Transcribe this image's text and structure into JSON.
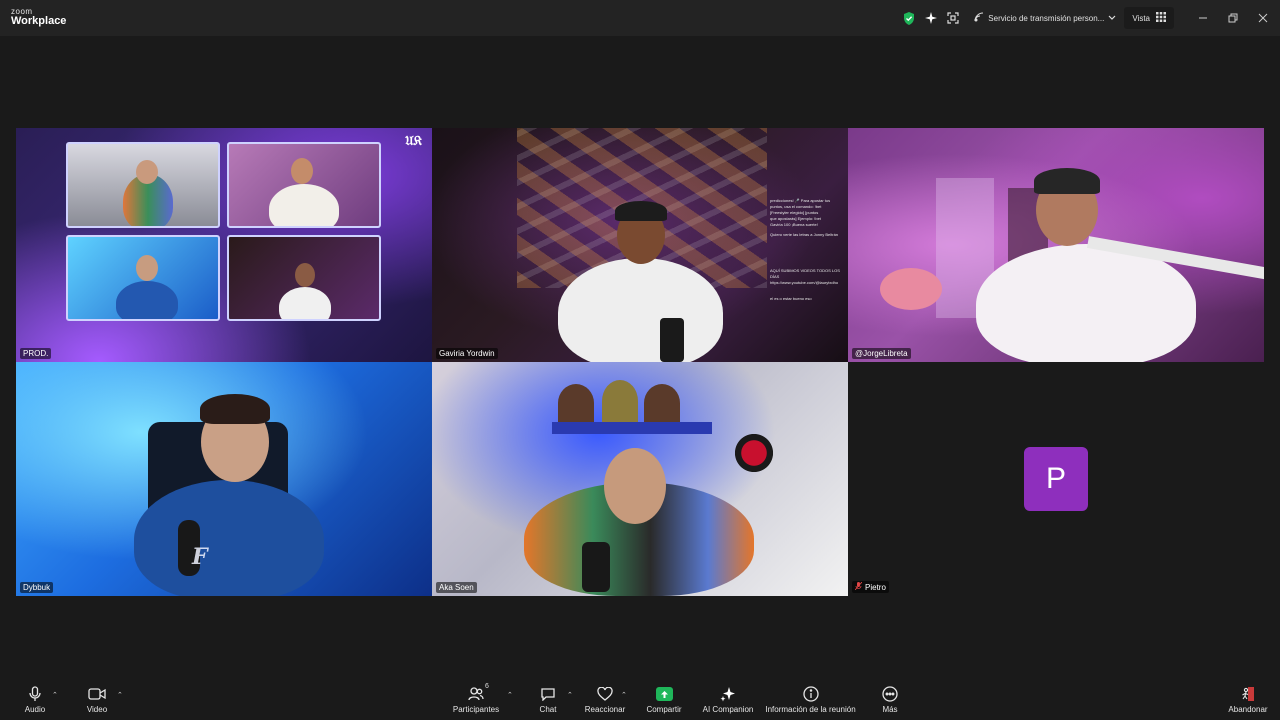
{
  "app": {
    "logo_top": "zoom",
    "logo_bottom": "Workplace"
  },
  "titlebar": {
    "stream_label": "Servicio de transmisión person...",
    "view_label": "Vista",
    "icons": [
      "shield-check-icon",
      "sparkle-icon",
      "fullscreen-icon",
      "broadcast-icon",
      "grid-icon",
      "minimize-icon",
      "restore-icon",
      "close-icon"
    ],
    "accent_color": "#1fb65a"
  },
  "participants": [
    {
      "name": "PROD."
    },
    {
      "name": "Gaviria Yordwin"
    },
    {
      "name": "@JorgeLibreta",
      "active_speaker": true
    },
    {
      "name": "Dybbuk"
    },
    {
      "name": "Aka Soen"
    },
    {
      "name": "Pietro",
      "avatar_letter": "P",
      "avatar_color": "#8e2fbd",
      "muted": true
    }
  ],
  "overlay_chat": {
    "lines": [
      "predicciones! 🎤 Para apostar tus",
      "puntos, usa el comando: !bet",
      "[Freestyler elegido] [puntos",
      "que apostarás] Ejemplo: !bet",
      "Gaviria 100 ¡Buena suerte!",
      "Quiero verte las letras a Jonny Beltrán",
      "AQUÍ SUBIMOS VIDEOS TODOS LOS DÍAS",
      "https://www.youtube.com/@laurytxdho",
      "el es o estar bueno eso"
    ]
  },
  "toolbar": {
    "audio": "Audio",
    "video": "Video",
    "participants": "Participantes",
    "participants_count": "6",
    "chat": "Chat",
    "react": "Reaccionar",
    "share": "Compartir",
    "ai_companion": "AI Companion",
    "meeting_info": "Información de la reunión",
    "more": "Más",
    "leave": "Abandonar"
  }
}
